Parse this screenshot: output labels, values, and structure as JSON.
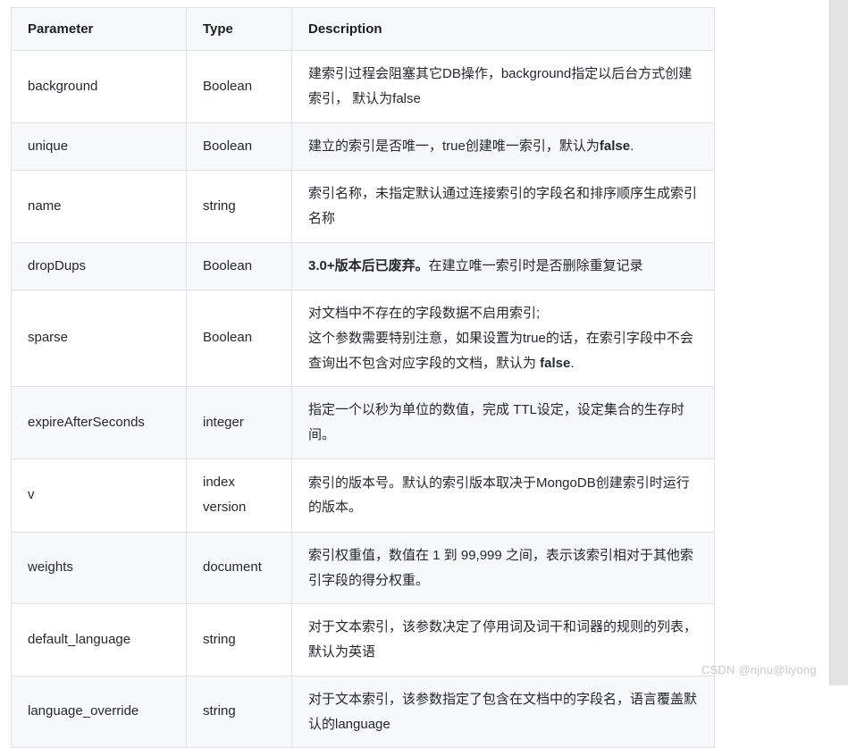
{
  "table": {
    "headers": [
      "Parameter",
      "Type",
      "Description"
    ],
    "rows": [
      {
        "parameter": "background",
        "type": "Boolean",
        "description": "建索引过程会阻塞其它DB操作，background指定以后台方式创建索引， 默认为false"
      },
      {
        "parameter": "unique",
        "type": "Boolean",
        "description": "建立的索引是否唯一，true创建唯一索引，默认为",
        "description_bold_tail": "false",
        "description_tail": "."
      },
      {
        "parameter": "name",
        "type": "string",
        "description": "索引名称，未指定默认通过连接索引的字段名和排序顺序生成索引名称"
      },
      {
        "parameter": "dropDups",
        "type": "Boolean",
        "description_bold_head": "3.0+版本后已废弃。",
        "description": "在建立唯一索引时是否删除重复记录"
      },
      {
        "parameter": "sparse",
        "type": "Boolean",
        "description_line1": "对文档中不存在的字段数据不启用索引;",
        "description_line2": "这个参数需要特别注意，如果设置为true的话，在索引字段中不会查询出不包含对应字段的文档，默认为 ",
        "description_bold_tail": "false",
        "description_tail": "."
      },
      {
        "parameter": "expireAfterSeconds",
        "type": "integer",
        "description": "指定一个以秒为单位的数值，完成 TTL设定，设定集合的生存时间。"
      },
      {
        "parameter": "v",
        "type": "index version",
        "description": "索引的版本号。默认的索引版本取决于MongoDB创建索引时运行的版本。"
      },
      {
        "parameter": "weights",
        "type": "document",
        "description": "索引权重值，数值在 1 到 99,999 之间，表示该索引相对于其他索引字段的得分权重。"
      },
      {
        "parameter": "default_language",
        "type": "string",
        "description": "对于文本索引，该参数决定了停用词及词干和词器的规则的列表， 默认为英语"
      },
      {
        "parameter": "language_override",
        "type": "string",
        "description": "对于文本索引，该参数指定了包含在文档中的字段名，语言覆盖默认的language"
      }
    ]
  },
  "watermark": {
    "text": "CSDN @njnu@liyong"
  },
  "colors": {
    "border": "#dfe2e5",
    "shade_row": "#f6f8fa",
    "text": "#24292e",
    "watermark": "#c9c9c9",
    "gutter": "#e3e3e3"
  }
}
